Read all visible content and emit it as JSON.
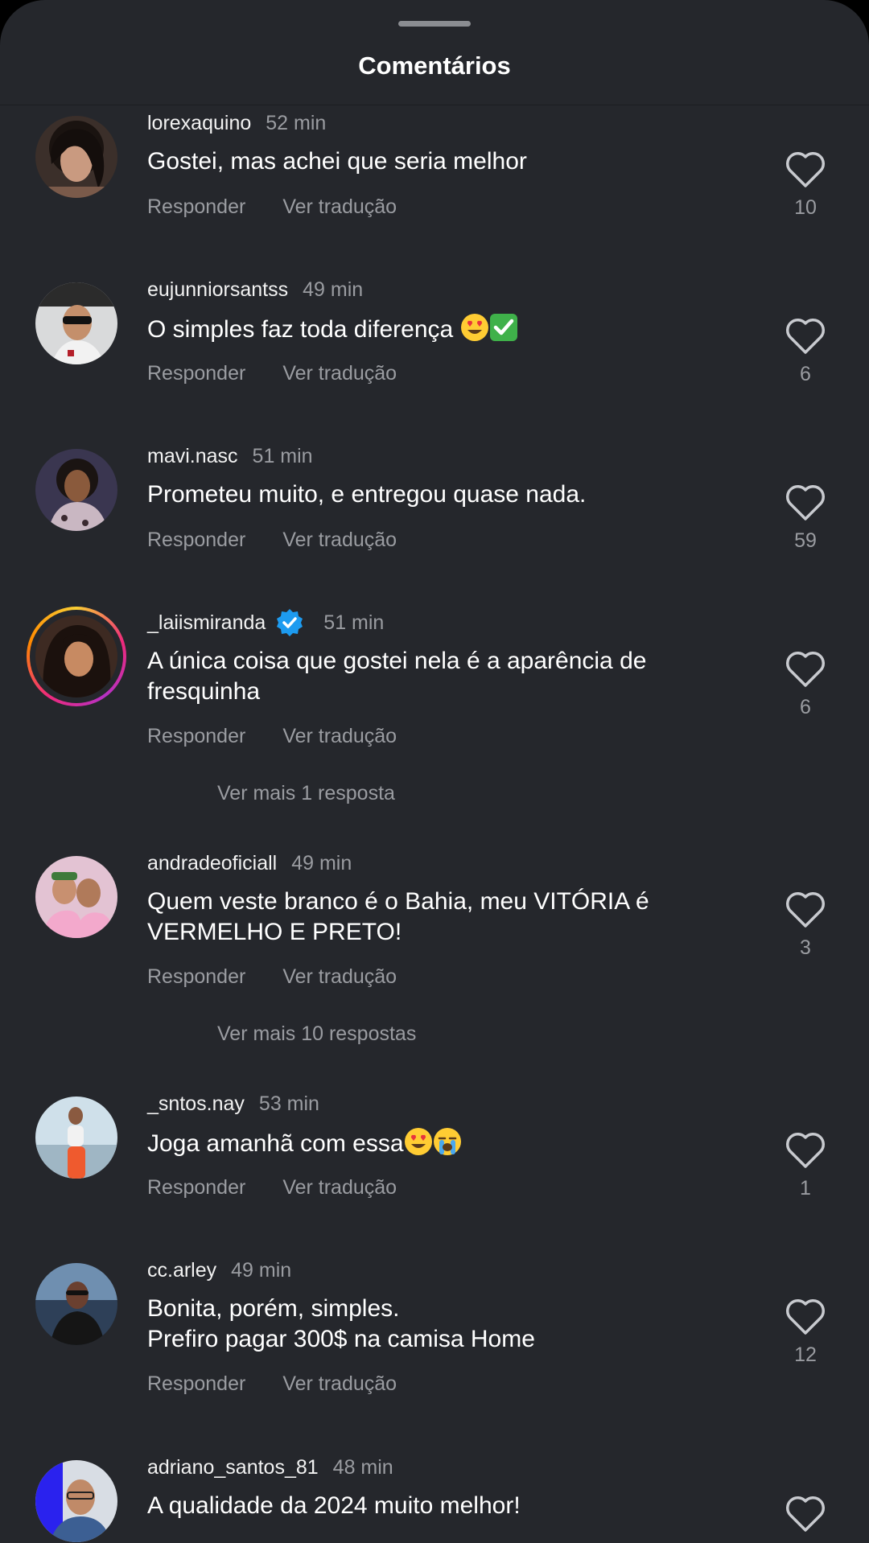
{
  "header": {
    "title": "Comentários"
  },
  "labels": {
    "reply": "Responder",
    "translate": "Ver tradução"
  },
  "comments": [
    {
      "username": "lorexaquino",
      "time": "52 min",
      "text": "Gostei, mas achei que seria melhor",
      "likes": "10"
    },
    {
      "username": "eujunniorsantss",
      "time": "49 min",
      "text": "O simples faz toda diferença",
      "likes": "6"
    },
    {
      "username": "mavi.nasc",
      "time": "51 min",
      "text": "Prometeu muito, e entregou quase nada.",
      "likes": "59"
    },
    {
      "username": "_laiismiranda",
      "time": "51 min",
      "text": "A única coisa que gostei nela é a aparência de\nfresquinha",
      "likes": "6",
      "verified": true,
      "more_replies": "Ver mais 1 resposta"
    },
    {
      "username": "andradeoficiall",
      "time": "49 min",
      "text": "Quem veste branco é o Bahia, meu VITÓRIA é\nVERMELHO E PRETO!",
      "likes": "3",
      "more_replies": "Ver mais 10 respostas"
    },
    {
      "username": "_sntos.nay",
      "time": "53 min",
      "text": "Joga amanhã com essa",
      "likes": "1"
    },
    {
      "username": "cc.arley",
      "time": "49 min",
      "text": "Bonita, porém, simples.\nPrefiro pagar 300$ na camisa Home",
      "likes": "12"
    },
    {
      "username": "adriano_santos_81",
      "time": "48 min",
      "text": "A qualidade da 2024 muito melhor!",
      "likes": ""
    }
  ],
  "icons": {
    "like": "heart-outline-icon",
    "verified": "verified-badge-icon",
    "emoji_heart_eyes": "heart-eyes-emoji",
    "emoji_check": "check-mark-emoji",
    "emoji_crying": "loudly-crying-emoji"
  },
  "colors": {
    "background": "#25272c",
    "text_primary": "#ffffff",
    "text_secondary": "#9a9ca1",
    "verified_blue": "#1d9bf0"
  }
}
